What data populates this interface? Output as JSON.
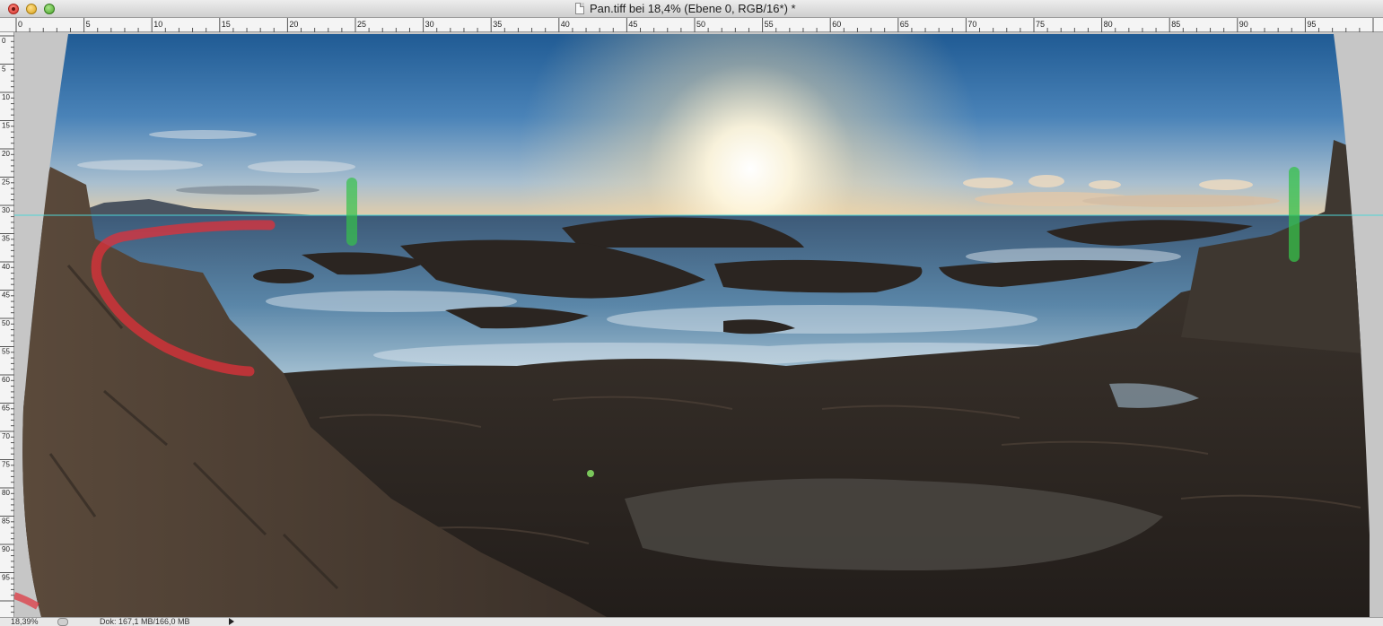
{
  "window": {
    "title": "Pan.tiff bei 18,4% (Ebene 0, RGB/16*) *"
  },
  "ruler": {
    "top_labels": [
      "0",
      "5",
      "10",
      "15",
      "20",
      "25",
      "30",
      "35",
      "40",
      "45",
      "50",
      "55",
      "60",
      "65",
      "70",
      "75",
      "80",
      "85",
      "90",
      "95"
    ],
    "left_labels": [
      "0",
      "5",
      "10",
      "15",
      "20",
      "25",
      "30",
      "35",
      "40",
      "45",
      "50",
      "55",
      "60",
      "65",
      "70",
      "75",
      "80",
      "85",
      "90",
      "95"
    ]
  },
  "canvas": {
    "image_description_icon": "panorama-photo",
    "guide_color": "#4fd6d6",
    "red_mask_color": "#e0303a",
    "green_mask_color": "#36c24a"
  },
  "status": {
    "zoom": "18,39%",
    "doc_size": "Dok: 167,1 MB/166,0 MB"
  },
  "colors": {
    "close": "#d2312a",
    "minimize": "#d9a21b",
    "maximize": "#4aa42a"
  }
}
